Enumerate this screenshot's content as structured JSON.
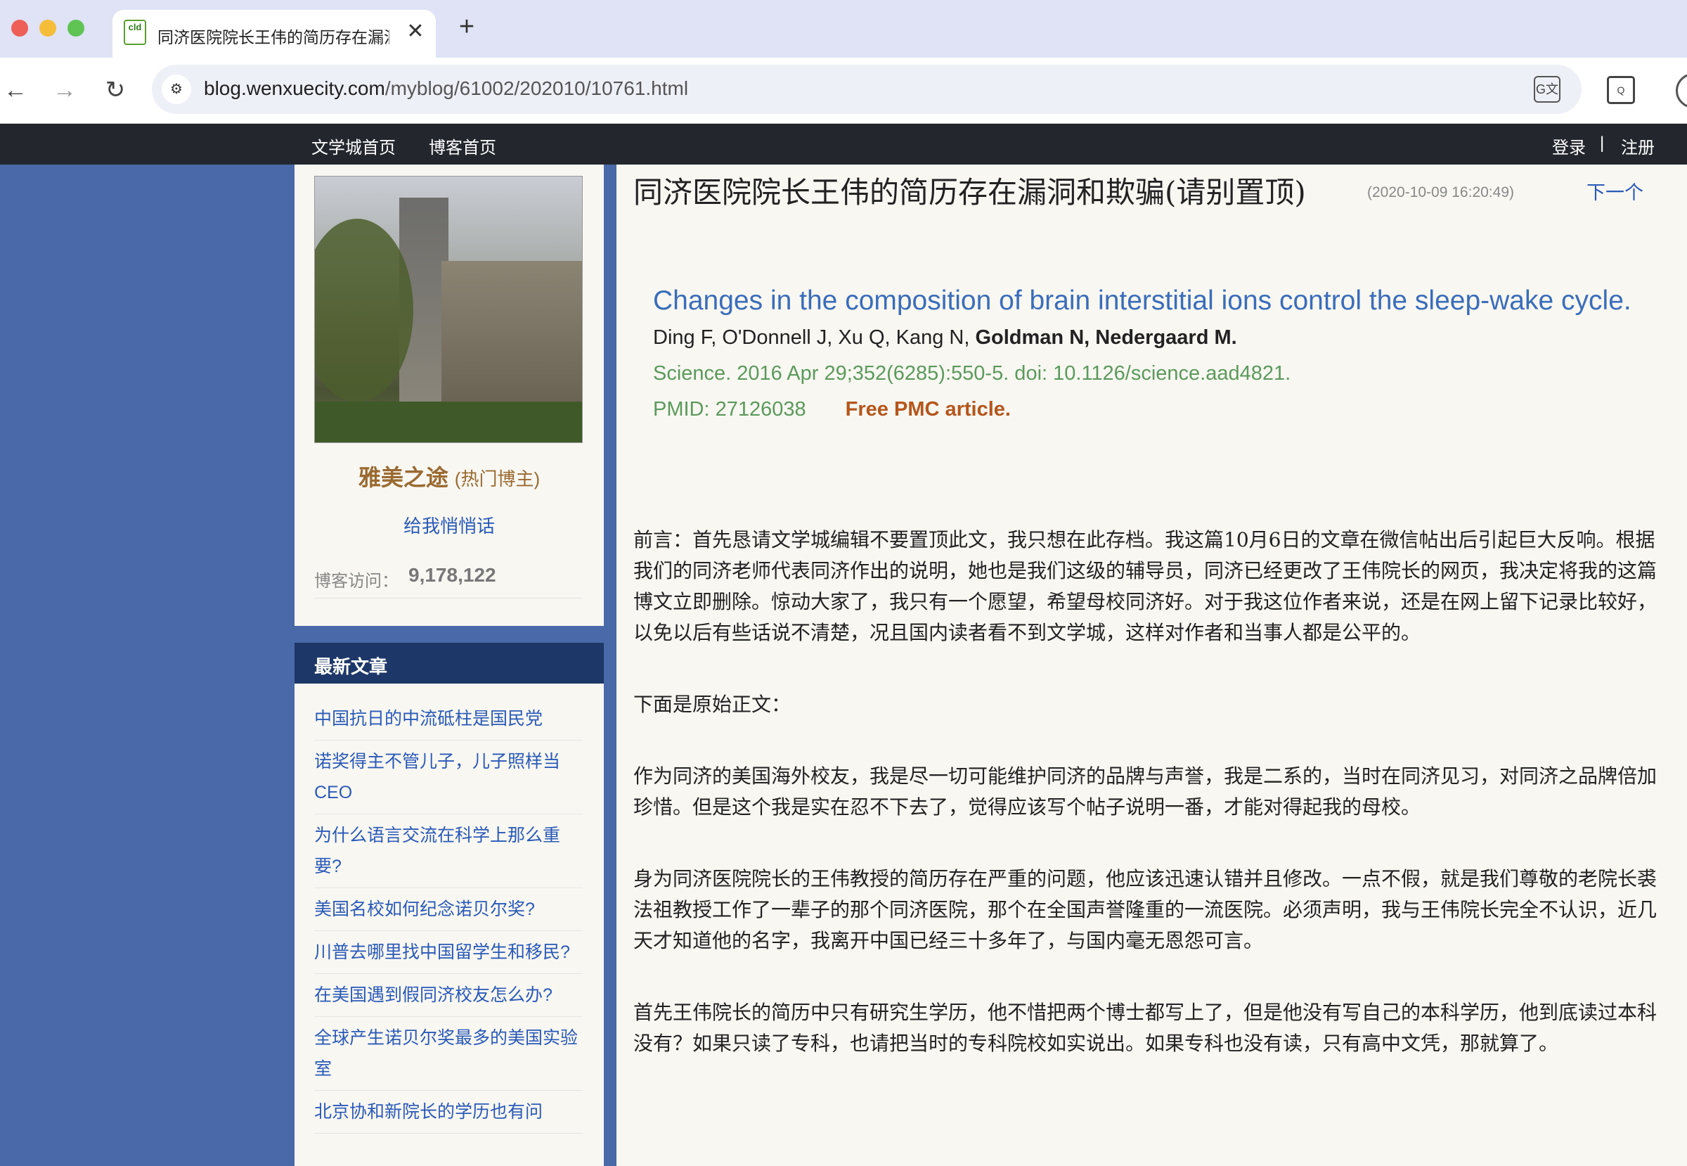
{
  "browser": {
    "tab_title": "同济医院院长王伟的简历存在漏洞和欺骗(请别置顶)",
    "tab_favicon_text": "cld",
    "close_glyph": "✕",
    "new_tab_glyph": "+",
    "url_host": "blog.wenxuecity.com",
    "url_path": "/myblog/61002/202010/10761.html",
    "back_glyph": "←",
    "forward_glyph": "→",
    "reload_glyph": "↻",
    "site_info_glyph": "⚙",
    "translate_glyph": "G文",
    "lens_glyph": "Q"
  },
  "topnav": {
    "home": "文学城首页",
    "blog_home": "博客首页",
    "login": "登录",
    "separator": "|",
    "register": "注册"
  },
  "profile": {
    "name": "雅美之途",
    "tag": "(热门博主)",
    "whisper": "给我悄悄话",
    "visits_label": "博客访问：",
    "visits_count": "9,178,122"
  },
  "recent": {
    "header": "最新文章",
    "items": [
      "中国抗日的中流砥柱是国民党",
      "诺奖得主不管儿子，儿子照样当CEO",
      "为什么语言交流在科学上那么重要?",
      "美国名校如何纪念诺贝尔奖?",
      "川普去哪里找中国留学生和移民?",
      "在美国遇到假同济校友怎么办?",
      "全球产生诺贝尔奖最多的美国实验室",
      "北京协和新院长的学历也有问"
    ]
  },
  "article": {
    "title": "同济医院院长王伟的简历存在漏洞和欺骗(请别置顶)",
    "date": "(2020-10-09 16:20:49)",
    "next": "下一个",
    "citation": {
      "title": "Changes in the composition of brain interstitial ions control the sleep-wake cycle.",
      "authors_plain": "Ding F, O'Donnell J, Xu Q, Kang N, ",
      "authors_bold": "Goldman N, Nedergaard M.",
      "journal": "Science. 2016 Apr 29;352(6285):550-5. doi: 10.1126/science.aad4821.",
      "pmid": "PMID: 27126038",
      "free": "Free PMC article."
    },
    "paragraphs": [
      "前言：首先恳请文学城编辑不要置顶此文，我只想在此存档。我这篇10月6日的文章在微信帖出后引起巨大反响。根据我们的同济老师代表同济作出的说明，她也是我们这级的辅导员，同济已经更改了王伟院长的网页，我决定将我的这篇博文立即删除。惊动大家了，我只有一个愿望，希望母校同济好。对于我这位作者来说，还是在网上留下记录比较好，以免以后有些话说不清楚，况且国内读者看不到文学城，这样对作者和当事人都是公平的。",
      "下面是原始正文：",
      "作为同济的美国海外校友，我是尽一切可能维护同济的品牌与声誉，我是二系的，当时在同济见习，对同济之品牌倍加珍惜。但是这个我是实在忍不下去了，觉得应该写个帖子说明一番，才能对得起我的母校。",
      "身为同济医院院长的王伟教授的简历存在严重的问题，他应该迅速认错并且修改。一点不假，就是我们尊敬的老院长裘法祖教授工作了一辈子的那个同济医院，那个在全国声誉隆重的一流医院。必须声明，我与王伟院长完全不认识，近几天才知道他的名字，我离开中国已经三十多年了，与国内毫无恩怨可言。",
      "首先王伟院长的简历中只有研究生学历，他不惜把两个博士都写上了，但是他没有写自己的本科学历，他到底读过本科没有？如果只读了专科，也请把当时的专科院校如实说出。如果专科也没有读，只有高中文凭，那就算了。"
    ]
  }
}
